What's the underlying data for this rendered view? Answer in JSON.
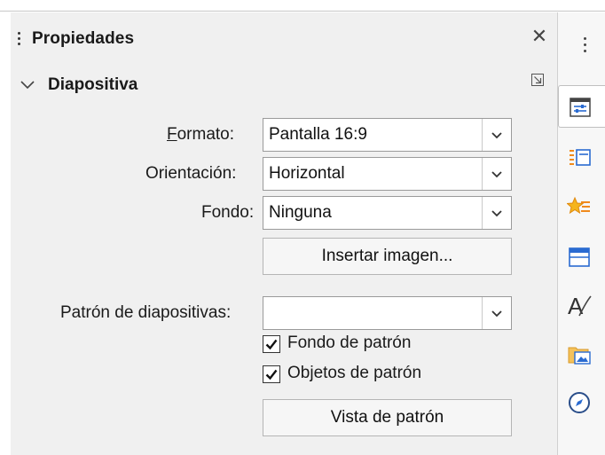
{
  "sidebar_panel": {
    "title": "Propiedades",
    "close_icon": "close-icon",
    "section": {
      "title": "Diapositiva",
      "expand_icon": "chevron-down-icon",
      "more_options_icon": "more-options-icon"
    },
    "format": {
      "label_u": "F",
      "label_rest": "ormato:",
      "value": "Pantalla 16:9"
    },
    "orientation": {
      "label": "Orientación:",
      "value": "Horizontal"
    },
    "background": {
      "label": "Fondo:",
      "value": "Ninguna"
    },
    "insert_image_button": "Insertar imagen...",
    "master_slide": {
      "label": "Patrón de diapositivas:",
      "value": ""
    },
    "master_background": {
      "label": "Fondo de patrón",
      "checked": true
    },
    "master_objects": {
      "label": "Objetos de patrón",
      "checked": true
    },
    "master_view_button": "Vista de patrón"
  },
  "tab_bar": {
    "tabs": [
      {
        "name": "properties",
        "icon": "properties-icon",
        "active": true
      },
      {
        "name": "slide-transition",
        "icon": "slide-transition-icon",
        "active": false
      },
      {
        "name": "animation",
        "icon": "animation-icon",
        "active": false
      },
      {
        "name": "master-slides",
        "icon": "master-slides-icon",
        "active": false
      },
      {
        "name": "styles",
        "icon": "styles-icon",
        "active": false
      },
      {
        "name": "gallery",
        "icon": "gallery-icon",
        "active": false
      },
      {
        "name": "navigator",
        "icon": "navigator-icon",
        "active": false
      }
    ]
  },
  "colors": {
    "panel_bg": "#f0f0f0",
    "accent": "#2a6bd1",
    "orange": "#f08a1c"
  }
}
